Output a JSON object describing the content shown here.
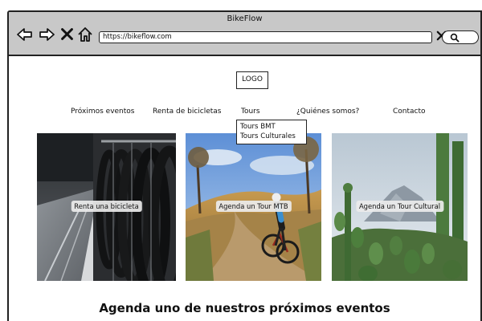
{
  "window": {
    "title": "BikeFlow"
  },
  "browser": {
    "url": "https://bikeflow.com",
    "icons": [
      "back-arrow-icon",
      "forward-arrow-icon",
      "close-x-icon",
      "home-icon",
      "search-icon"
    ]
  },
  "header": {
    "logo_label": "LOGO"
  },
  "nav": {
    "items": [
      {
        "label": "Próximos eventos"
      },
      {
        "label": "Renta de bicicletas"
      },
      {
        "label": "Tours"
      },
      {
        "label": "¿Quiénes somos?"
      },
      {
        "label": "Contacto"
      }
    ],
    "tours_dropdown": [
      "Tours BMT",
      "Tours Culturales"
    ]
  },
  "cards": [
    {
      "label": "Renta una bicicleta"
    },
    {
      "label": "Agenda un Tour MTB"
    },
    {
      "label": "Agenda un Tour Cultural"
    }
  ],
  "events_section": {
    "heading": "Agenda uno de nuestros próximos eventos"
  },
  "colors": {
    "chrome": "#c8c8c8",
    "outline": "#222222",
    "page": "#ffffff"
  }
}
